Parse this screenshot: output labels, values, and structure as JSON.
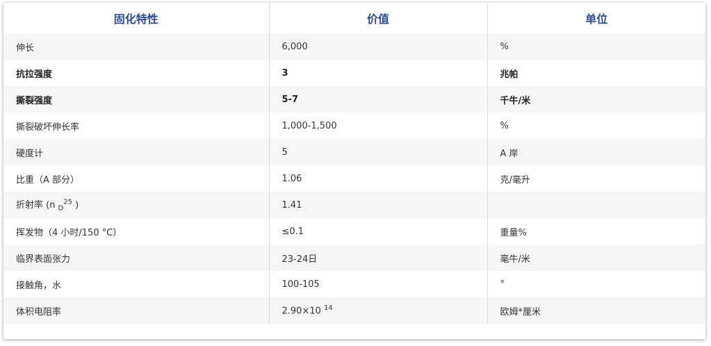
{
  "headers": [
    "固化特性",
    "价值",
    "单位"
  ],
  "rows": [
    {
      "property": "伸长",
      "value": "6,000",
      "unit": "%"
    },
    {
      "property": "抗拉强度",
      "value": "3",
      "unit": "兆帕",
      "bold": true
    },
    {
      "property": "撕裂强度",
      "value": "5-7",
      "unit": "千牛/米",
      "bold": true
    },
    {
      "property": "撕裂破坏伸长率",
      "value": "1,000-1,500",
      "unit": "%"
    },
    {
      "property": "硬度计",
      "value": "5",
      "unit": "A 岸"
    },
    {
      "property": "比重（A 部分）",
      "value": "1.06",
      "unit": "克/毫升"
    },
    {
      "property_prefix": "折射率 (n ",
      "property_sub": "D",
      "property_sup": "25",
      "property_suffix": " )",
      "value": "1.41",
      "unit": ""
    },
    {
      "property": "挥发物（4 小时/150 °C）",
      "value": "≤0.1",
      "unit": "重量%"
    },
    {
      "property": "临界表面张力",
      "value": "23-24日",
      "unit": "毫牛/米"
    },
    {
      "property": "接触角，水",
      "value": "100-105",
      "unit": "°"
    },
    {
      "property": "体积电阻率",
      "value_base": "2.90×10 ",
      "value_sup": "14",
      "unit": "欧姆*厘米"
    }
  ]
}
